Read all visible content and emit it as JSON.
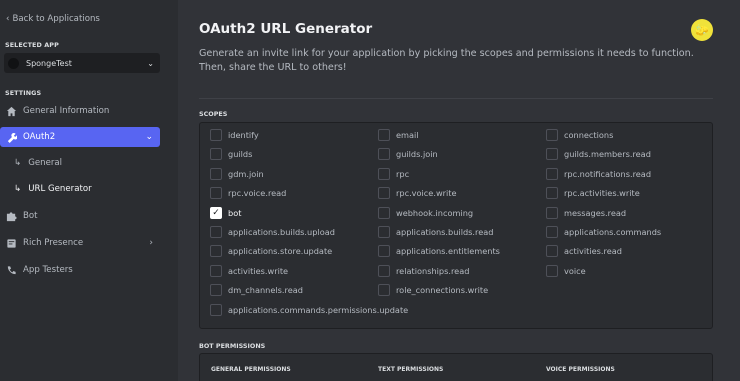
{
  "sidebar": {
    "back_label": "Back to Applications",
    "selected_app_heading": "SELECTED APP",
    "selected_app": "SpongeTest",
    "settings_heading": "SETTINGS",
    "items": [
      {
        "label": "General Information",
        "icon": "home-icon"
      },
      {
        "label": "OAuth2",
        "icon": "wrench-icon",
        "active": true
      },
      {
        "label": "General",
        "icon": "subitem-arrow-icon"
      },
      {
        "label": "URL Generator",
        "icon": "subitem-arrow-icon"
      },
      {
        "label": "Bot",
        "icon": "puzzle-icon"
      },
      {
        "label": "Rich Presence",
        "icon": "document-icon"
      },
      {
        "label": "App Testers",
        "icon": "phone-icon"
      }
    ]
  },
  "main": {
    "title": "OAuth2 URL Generator",
    "description": "Generate an invite link for your application by picking the scopes and permissions it needs to function. Then, share the URL to others!",
    "scopes_heading": "SCOPES",
    "bot_permissions_heading": "BOT PERMISSIONS",
    "permission_columns": [
      "GENERAL PERMISSIONS",
      "TEXT PERMISSIONS",
      "VOICE PERMISSIONS"
    ],
    "scopes": [
      [
        "identify",
        "email",
        "connections"
      ],
      [
        "guilds",
        "guilds.join",
        "guilds.members.read"
      ],
      [
        "gdm.join",
        "rpc",
        "rpc.notifications.read"
      ],
      [
        "rpc.voice.read",
        "rpc.voice.write",
        "rpc.activities.write"
      ],
      [
        "bot",
        "webhook.incoming",
        "messages.read"
      ],
      [
        "applications.builds.upload",
        "applications.builds.read",
        "applications.commands"
      ],
      [
        "applications.store.update",
        "applications.entitlements",
        "activities.read"
      ],
      [
        "activities.write",
        "relationships.read",
        "voice"
      ],
      [
        "dm_channels.read",
        "role_connections.write"
      ],
      [
        "applications.commands.permissions.update"
      ]
    ],
    "checked_scopes": [
      "bot"
    ]
  }
}
